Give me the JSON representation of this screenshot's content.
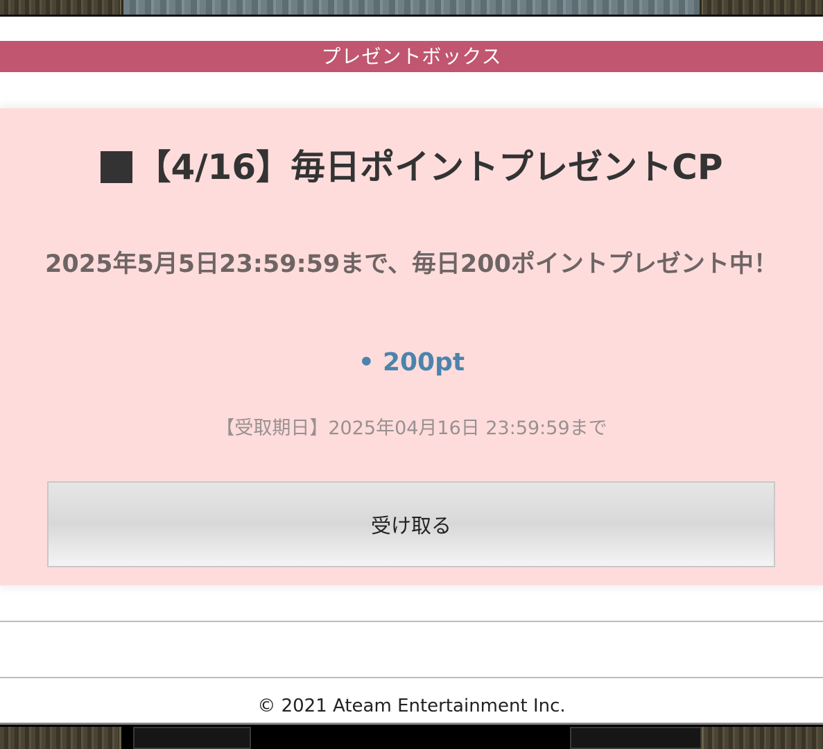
{
  "header": {
    "title": "プレゼントボックス"
  },
  "present": {
    "title": "【4/16】毎日ポイントプレゼントCP",
    "description": "2025年5月5日23:59:59まで、毎日200ポイントプレゼント中！",
    "reward_bullet": "•",
    "reward": "200pt",
    "deadline": "【受取期日】2025年04月16日 23:59:59まで",
    "receive_button": "受け取る"
  },
  "footer": {
    "copyright": "© 2021 Ateam Entertainment Inc."
  },
  "colors": {
    "header_bg": "#c0566f",
    "card_bg": "#ffdcdc",
    "reward_text": "#4a84ac"
  }
}
